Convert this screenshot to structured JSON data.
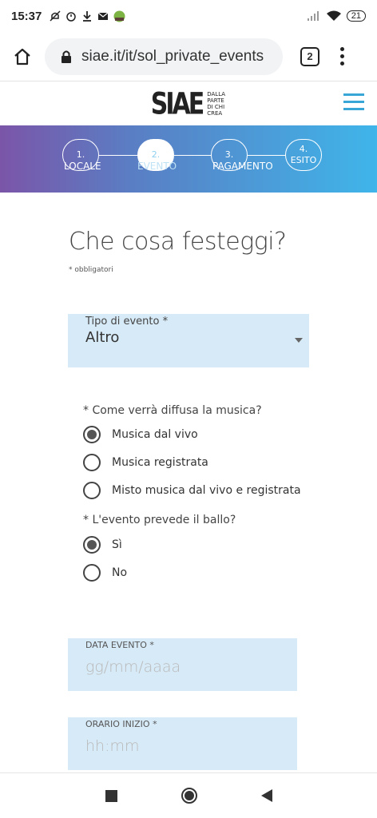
{
  "status_bar": {
    "time": "15:37",
    "battery": "21"
  },
  "browser": {
    "url": "siae.it/it/sol_private_events",
    "tab_count": "2"
  },
  "header": {
    "logo_text": "SIAE",
    "logo_tagline": "DALLA PARTE DI CHI CREA"
  },
  "stepper": {
    "steps": [
      {
        "number": "1.",
        "label": "LOCALE"
      },
      {
        "number": "2.",
        "label": "EVENTO"
      },
      {
        "number": "3.",
        "label": "PAGAMENTO"
      },
      {
        "number": "4. ESITO",
        "label": ""
      }
    ]
  },
  "form": {
    "title": "Che cosa festeggi?",
    "required_note": "* obbligatori",
    "event_type": {
      "label": "Tipo di evento *",
      "value": "Altro"
    },
    "music_question": "* Come verrà diffusa la musica?",
    "music_options": [
      "Musica dal vivo",
      "Musica registrata",
      "Misto musica dal vivo e registrata"
    ],
    "dance_question": "* L'evento prevede il ballo?",
    "dance_options": [
      "Sì",
      "No"
    ],
    "event_date": {
      "label": "DATA EVENTO *",
      "placeholder": "gg/mm/aaaa"
    },
    "start_time": {
      "label": "ORARIO INIZIO *",
      "placeholder": "hh:mm"
    }
  }
}
